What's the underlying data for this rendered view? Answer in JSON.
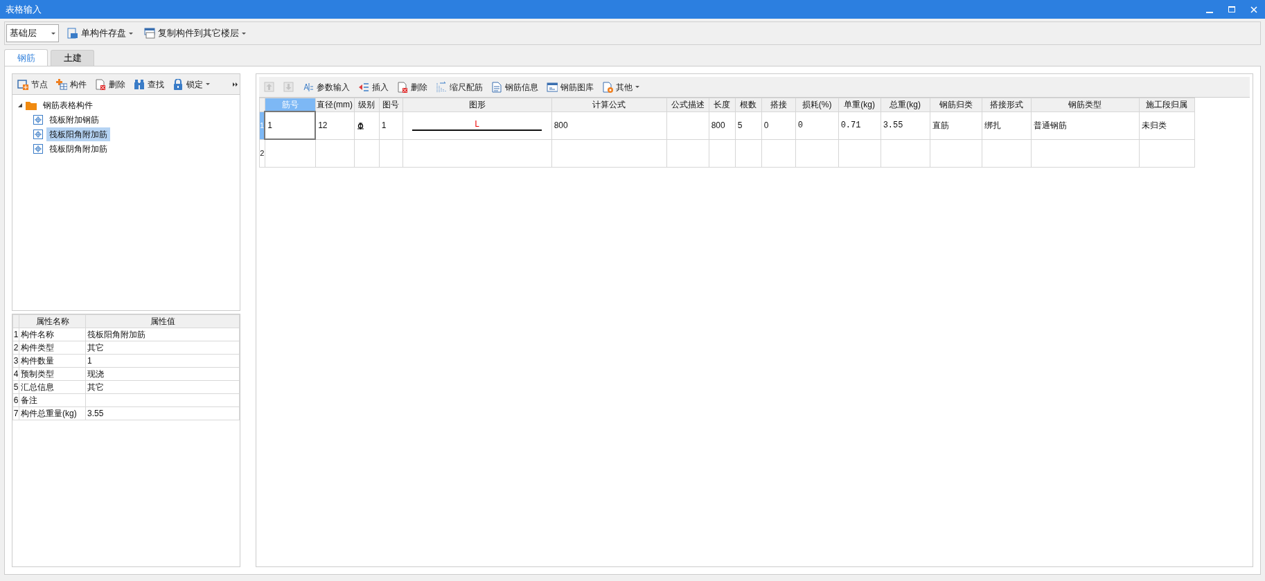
{
  "window": {
    "title": "表格输入"
  },
  "top_toolbar": {
    "floor_select": {
      "value": "基础层"
    },
    "buttons": [
      {
        "kind": "save",
        "label": "单构件存盘",
        "dropdown": true
      },
      {
        "kind": "copy",
        "label": "复制构件到其它楼层",
        "dropdown": true
      }
    ]
  },
  "tabs": [
    {
      "label": "钢筋",
      "selected": true
    },
    {
      "label": "土建",
      "selected": false
    }
  ],
  "left_toolbar": [
    {
      "kind": "node",
      "label": "节点",
      "dropdown": false
    },
    {
      "kind": "component",
      "label": "构件",
      "dropdown": false
    },
    {
      "kind": "delete",
      "label": "删除",
      "dropdown": false
    },
    {
      "kind": "find",
      "label": "查找",
      "dropdown": false
    },
    {
      "kind": "lock",
      "label": "锁定",
      "dropdown": true
    }
  ],
  "tree": [
    {
      "label": "钢筋表格构件",
      "expanded": true,
      "selected": false,
      "children": [
        {
          "label": "筏板附加钢筋",
          "selected": false
        },
        {
          "label": "筏板阳角附加筋",
          "selected": true
        },
        {
          "label": "筏板阴角附加筋",
          "selected": false
        }
      ]
    }
  ],
  "properties": {
    "columns": [
      "属性名称",
      "属性值"
    ],
    "rows": [
      {
        "index": "1",
        "name": "构件名称",
        "value": "筏板阳角附加筋"
      },
      {
        "index": "2",
        "name": "构件类型",
        "value": "其它"
      },
      {
        "index": "3",
        "name": "构件数量",
        "value": "1"
      },
      {
        "index": "4",
        "name": "预制类型",
        "value": "现浇"
      },
      {
        "index": "5",
        "name": "汇总信息",
        "value": "其它"
      },
      {
        "index": "6",
        "name": "备注",
        "value": ""
      },
      {
        "index": "7",
        "name": "构件总重量(kg)",
        "value": "3.55"
      }
    ]
  },
  "grid_toolbar": [
    {
      "kind": "up",
      "dropdown": false,
      "disabled": true
    },
    {
      "kind": "down",
      "dropdown": false,
      "disabled": true
    },
    {
      "kind": "param",
      "label": "参数输入",
      "dropdown": false,
      "disabled": false
    },
    {
      "kind": "insert",
      "label": "插入",
      "dropdown": false,
      "disabled": false
    },
    {
      "kind": "delete",
      "label": "删除",
      "dropdown": false,
      "disabled": false
    },
    {
      "kind": "scale",
      "label": "缩尺配筋",
      "dropdown": false,
      "disabled": false
    },
    {
      "kind": "info",
      "label": "钢筋信息",
      "dropdown": false,
      "disabled": false
    },
    {
      "kind": "library",
      "label": "钢筋图库",
      "dropdown": false,
      "disabled": false
    },
    {
      "kind": "other",
      "label": "其他",
      "dropdown": true,
      "disabled": false
    }
  ],
  "grid": {
    "columns": [
      {
        "label": "筋号",
        "selected": true
      },
      {
        "label": "直径(mm)",
        "selected": false
      },
      {
        "label": "级别",
        "selected": false
      },
      {
        "label": "图号",
        "selected": false
      },
      {
        "label": "图形",
        "selected": false
      },
      {
        "label": "计算公式",
        "selected": false
      },
      {
        "label": "公式描述",
        "selected": false
      },
      {
        "label": "长度",
        "selected": false
      },
      {
        "label": "根数",
        "selected": false
      },
      {
        "label": "搭接",
        "selected": false
      },
      {
        "label": "损耗(%)",
        "selected": false
      },
      {
        "label": "单重(kg)",
        "selected": false
      },
      {
        "label": "总重(kg)",
        "selected": false
      },
      {
        "label": "钢筋归类",
        "selected": false
      },
      {
        "label": "搭接形式",
        "selected": false
      },
      {
        "label": "钢筋类型",
        "selected": false
      },
      {
        "label": "施工段归属",
        "selected": false
      }
    ],
    "rows": [
      {
        "index": "1",
        "selected": true,
        "cells": [
          {
            "kind": "text",
            "text": "1"
          },
          {
            "kind": "text",
            "text": "12"
          },
          {
            "kind": "grade"
          },
          {
            "kind": "text",
            "text": "1"
          },
          {
            "kind": "shape",
            "text": "L"
          },
          {
            "kind": "text",
            "text": "800"
          },
          {
            "kind": "text",
            "text": ""
          },
          {
            "kind": "text",
            "text": "800"
          },
          {
            "kind": "text",
            "text": "5"
          },
          {
            "kind": "text",
            "text": "0"
          },
          {
            "kind": "text",
            "text": "0"
          },
          {
            "kind": "text",
            "text": "0.71"
          },
          {
            "kind": "text",
            "text": "3.55"
          },
          {
            "kind": "text",
            "text": "直筋"
          },
          {
            "kind": "text",
            "text": "绑扎"
          },
          {
            "kind": "text",
            "text": "普通钢筋"
          },
          {
            "kind": "text",
            "text": "未归类"
          }
        ]
      },
      {
        "index": "2",
        "selected": false,
        "cells": []
      }
    ]
  }
}
